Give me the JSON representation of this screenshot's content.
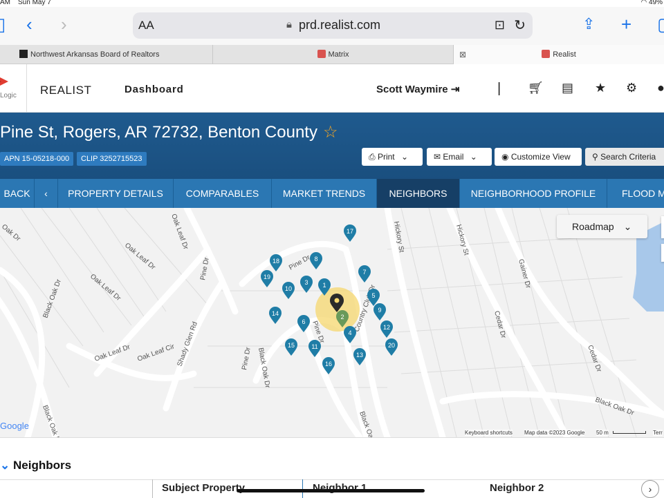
{
  "status": {
    "time": "AM",
    "date": "Sun May 7",
    "battery": "49%"
  },
  "browser": {
    "aa": "AA",
    "url": "prd.realist.com"
  },
  "tabs": [
    {
      "label": "Northwest Arkansas Board of Realtors"
    },
    {
      "label": "Matrix"
    },
    {
      "label": "Realist"
    }
  ],
  "header": {
    "logo_text": "Logic",
    "app_name": "REALIST",
    "dashboard": "Dashboard",
    "user": "Scott Waymire"
  },
  "banner": {
    "address": "Pine St, Rogers, AR 72732, Benton County",
    "apn": "APN 15-05218-000",
    "clip": "CLIP 3252715523",
    "print": "Print",
    "email": "Email",
    "customize": "Customize View",
    "search_criteria": "Search Criteria"
  },
  "nav": {
    "back": "BACK",
    "items": [
      "PROPERTY DETAILS",
      "COMPARABLES",
      "MARKET TRENDS",
      "NEIGHBORS",
      "NEIGHBORHOOD PROFILE",
      "FLOOD M"
    ]
  },
  "map": {
    "roadmap": "Roadmap",
    "streets": [
      "Oak Dr",
      "Oak Leaf Dr",
      "Black Oak Dr",
      "Oak Leaf Dr",
      "Oak Leaf Dr",
      "Oak Leaf Cir",
      "Shady Glen Rd",
      "Oak Leaf Dr",
      "Pine Dr",
      "Pine Dr",
      "Pine Dr",
      "Black Oak Dr",
      "Pine Dr",
      "Country Club Dr",
      "Hickory St",
      "Hickory St",
      "Cedar Dr",
      "Gainer Dr",
      "Cedar Dr",
      "Black Oak Dr",
      "Black Oak Dr",
      "Black Oak Dr"
    ],
    "pins": [
      "17",
      "18",
      "8",
      "19",
      "7",
      "10",
      "3",
      "1",
      "5",
      "14",
      "9",
      "6",
      "2",
      "4",
      "12",
      "15",
      "11",
      "20",
      "13",
      "16"
    ],
    "google": "Google",
    "keyboard": "Keyboard shortcuts",
    "mapdata": "Map data ©2023 Google",
    "scale": "50 m",
    "terms": "Terr"
  },
  "neighbors": {
    "title": "Neighbors",
    "subject": "Subject Property",
    "n1": "Neighbor 1",
    "n2": "Neighbor 2"
  },
  "colors": {
    "banner": "#1f5a8e",
    "nav": "#2b77b3",
    "nav_active": "#163f66",
    "pin": "#1f7da6",
    "pin_subject": "#6a9a5a",
    "highlight": "#f5d76e"
  }
}
